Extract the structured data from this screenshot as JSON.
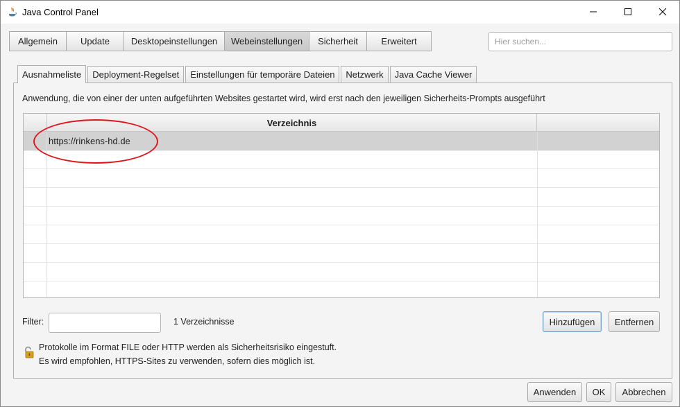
{
  "window": {
    "title": "Java Control Panel"
  },
  "top_tabs": [
    "Allgemein",
    "Update",
    "Desktopeinstellungen",
    "Webeinstellungen",
    "Sicherheit",
    "Erweitert"
  ],
  "search": {
    "placeholder": "Hier suchen..."
  },
  "sub_tabs": [
    "Ausnahmeliste",
    "Deployment-Regelset",
    "Einstellungen für temporäre Dateien",
    "Netzwerk",
    "Java Cache Viewer"
  ],
  "panel": {
    "description": "Anwendung, die von einer der unten aufgeführten Websites gestartet wird, wird erst nach den jeweiligen Sicherheits-Prompts ausgeführt",
    "table": {
      "column": "Verzeichnis",
      "rows": [
        "https://rinkens-hd.de"
      ]
    },
    "filter_label": "Filter:",
    "count_text": "1 Verzeichnisse",
    "add_label": "Hinzufügen",
    "remove_label": "Entfernen",
    "warning_line1": "Protokolle im Format FILE oder HTTP werden als Sicherheitsrisiko eingestuft.",
    "warning_line2": "Es wird empfohlen, HTTPS-Sites zu verwenden, sofern dies möglich ist."
  },
  "buttons": {
    "apply": "Anwenden",
    "ok": "OK",
    "cancel": "Abbrechen"
  },
  "colors": {
    "highlight": "#e0161c",
    "selected_row": "#d2d2d2",
    "default_button_border": "#6f9ec9"
  },
  "icons": [
    "java-icon",
    "minimize-icon",
    "maximize-icon",
    "close-icon",
    "unlock-warning-icon"
  ]
}
